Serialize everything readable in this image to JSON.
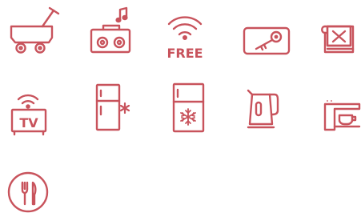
{
  "colors": {
    "icon_stroke": "#c8535c",
    "background": "#ffffff"
  },
  "icons": [
    {
      "name": "luggage-cart-icon"
    },
    {
      "name": "boombox-music-icon"
    },
    {
      "name": "free-wifi-icon",
      "text": "FREE"
    },
    {
      "name": "key-card-icon"
    },
    {
      "name": "book-with-x-icon"
    },
    {
      "name": "tv-icon",
      "text": "TV"
    },
    {
      "name": "refrigerator-icon"
    },
    {
      "name": "freezer-icon"
    },
    {
      "name": "electric-kettle-icon"
    },
    {
      "name": "coffee-machine-icon"
    },
    {
      "name": "restaurant-fork-knife-icon"
    }
  ]
}
